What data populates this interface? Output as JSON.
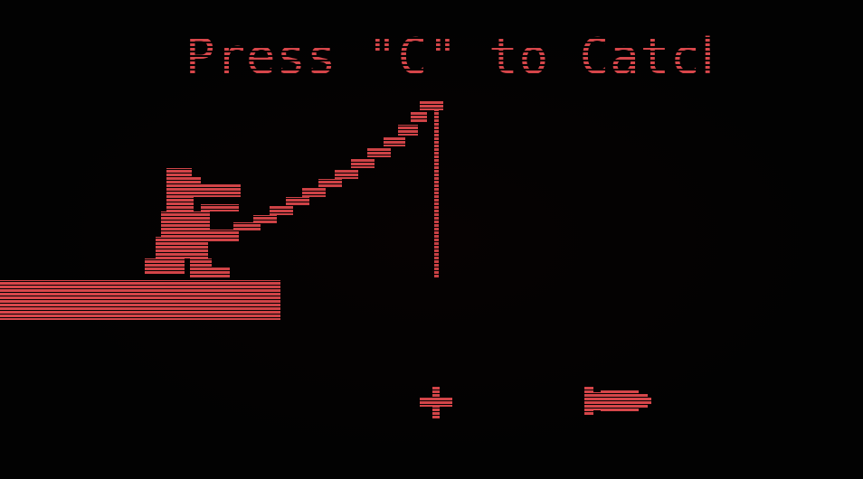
{
  "prompt": "Press \"C\" to Catch",
  "colors": {
    "sprite": "#d9474b",
    "background": "#020202"
  },
  "sprites": {
    "player": "fisherman-crocodile",
    "rod": "fishing-rod",
    "line": "fishing-line",
    "dock": "wooden-dock",
    "target": "crosshair-marker",
    "fish": "swimming-fish"
  }
}
